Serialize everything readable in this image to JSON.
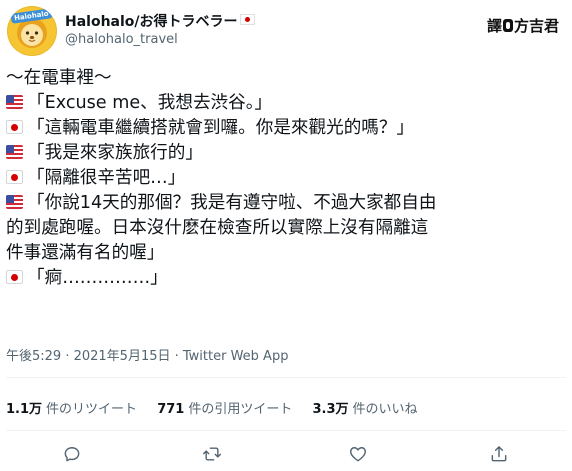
{
  "header": {
    "display_name": "Halohalo/お得トラベラー",
    "handle": "@halohalo_travel",
    "avatar_logo_text": "Halohalo",
    "translator_prefix": "譯",
    "translator_name": "方吉君"
  },
  "tweet": {
    "lines": [
      {
        "flag": "",
        "text": "～在電車裡～"
      },
      {
        "flag": "us",
        "text": "「Excuse me、我想去渋谷。」"
      },
      {
        "flag": "jp",
        "text": "「這輛電車繼續搭就會到囉。你是來觀光的嗎？」"
      },
      {
        "flag": "us",
        "text": "「我是來家族旅行的」"
      },
      {
        "flag": "jp",
        "text": "「隔離很辛苦吧…」"
      },
      {
        "flag": "us",
        "text": "「你說14天的那個？我是有遵守啦、不過大家都自由"
      },
      {
        "flag": "",
        "text": "的到處跑喔。日本沒什麽在檢查所以實際上沒有隔離這"
      },
      {
        "flag": "",
        "text": "件事還滿有名的喔」"
      },
      {
        "flag": "jp",
        "text": "「痾……………」"
      }
    ]
  },
  "meta": {
    "timestamp": "午後5:29 · 2021年5月15日 · Twitter Web App"
  },
  "stats": [
    {
      "value": "1.1万",
      "label": "件のリツイート"
    },
    {
      "value": "771",
      "label": "件の引用ツイート"
    },
    {
      "value": "3.3万",
      "label": "件のいいね"
    }
  ],
  "actions": [
    {
      "icon": "reply-icon"
    },
    {
      "icon": "retweet-icon"
    },
    {
      "icon": "like-icon"
    },
    {
      "icon": "share-icon"
    }
  ],
  "colors": {
    "text": "#0f1419",
    "secondary": "#536471",
    "divider": "#eff3f4",
    "avatar_bg": "#f7c531"
  }
}
